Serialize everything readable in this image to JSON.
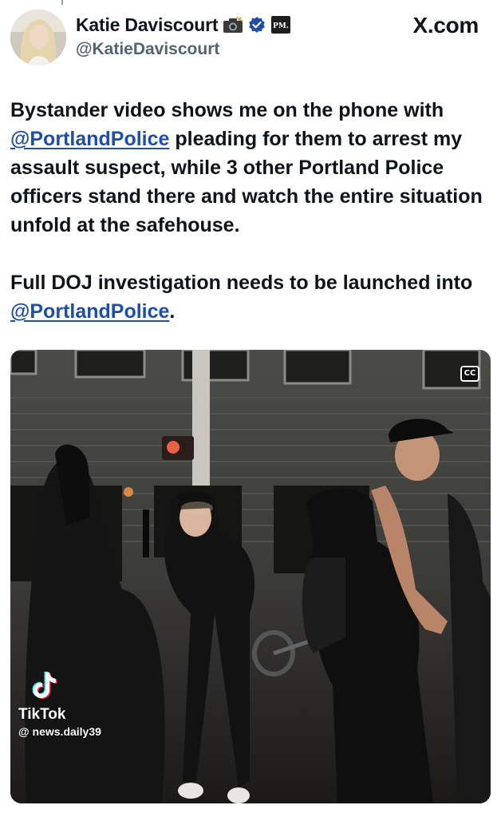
{
  "post": {
    "author": {
      "display_name": "Katie Daviscourt",
      "handle": "@KatieDaviscourt",
      "badges": [
        "camera-icon",
        "verified-icon",
        "pm-logo-icon"
      ],
      "pm_badge_text": "PM."
    },
    "brand": "X.com",
    "text": {
      "p1_before": "Bystander video shows me on the phone with ",
      "p1_mention": "@PortlandPolice",
      "p1_after": " pleading for them to arrest my assault suspect, while 3 other Portland Police officers stand there and watch the entire situation unfold at the safehouse.",
      "p2_before": "Full DOJ investigation needs to be launched into ",
      "p2_mention": "@PortlandPolice",
      "p2_after": "."
    },
    "media": {
      "cc_label": "CC",
      "watermark": {
        "app_name": "TikTok",
        "username": "@ news.daily39"
      }
    }
  },
  "colors": {
    "text": "#0f1419",
    "secondary_text": "#536471",
    "mention": "#1d4ea8",
    "verified": "#1d4ea8"
  }
}
